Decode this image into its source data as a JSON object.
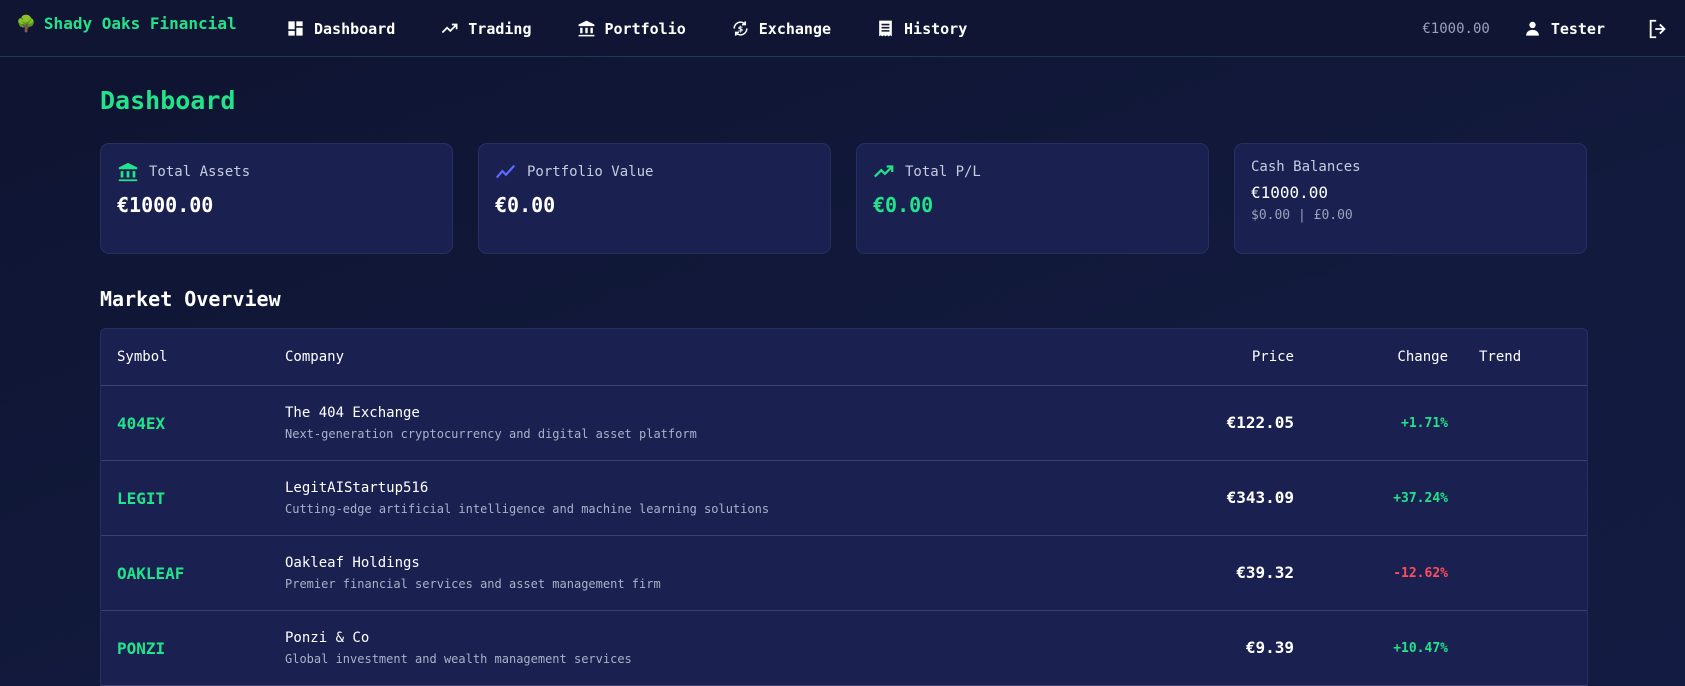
{
  "nav": {
    "brand": "Shady Oaks Financial",
    "links": [
      {
        "label": "Dashboard",
        "icon": "dashboard-icon"
      },
      {
        "label": "Trading",
        "icon": "trending-icon"
      },
      {
        "label": "Portfolio",
        "icon": "bank-icon"
      },
      {
        "label": "Exchange",
        "icon": "currency-exchange-icon"
      },
      {
        "label": "History",
        "icon": "receipt-icon"
      }
    ],
    "balance": "€1000.00",
    "user": "Tester"
  },
  "page": {
    "title": "Dashboard",
    "cards": {
      "total_assets": {
        "label": "Total Assets",
        "value": "€1000.00"
      },
      "portfolio_value": {
        "label": "Portfolio Value",
        "value": "€0.00"
      },
      "total_pl": {
        "label": "Total P/L",
        "value": "€0.00"
      },
      "cash": {
        "label": "Cash Balances",
        "main": "€1000.00",
        "sub": "$0.00 | £0.00"
      }
    },
    "market": {
      "title": "Market Overview",
      "headers": {
        "symbol": "Symbol",
        "company": "Company",
        "price": "Price",
        "change": "Change",
        "trend": "Trend"
      },
      "rows": [
        {
          "symbol": "404EX",
          "name": "The 404 Exchange",
          "desc": "Next-generation cryptocurrency and digital asset platform",
          "price": "€122.05",
          "change": "+1.71%"
        },
        {
          "symbol": "LEGIT",
          "name": "LegitAIStartup516",
          "desc": "Cutting-edge artificial intelligence and machine learning solutions",
          "price": "€343.09",
          "change": "+37.24%"
        },
        {
          "symbol": "OAKLEAF",
          "name": "Oakleaf Holdings",
          "desc": "Premier financial services and asset management firm",
          "price": "€39.32",
          "change": "-12.62%"
        },
        {
          "symbol": "PONZI",
          "name": "Ponzi & Co",
          "desc": "Global investment and wealth management services",
          "price": "€9.39",
          "change": "+10.47%"
        }
      ]
    }
  },
  "colors": {
    "accent": "#22e38a",
    "negative": "#ff4d5e",
    "link_blue": "#5b6cff"
  }
}
